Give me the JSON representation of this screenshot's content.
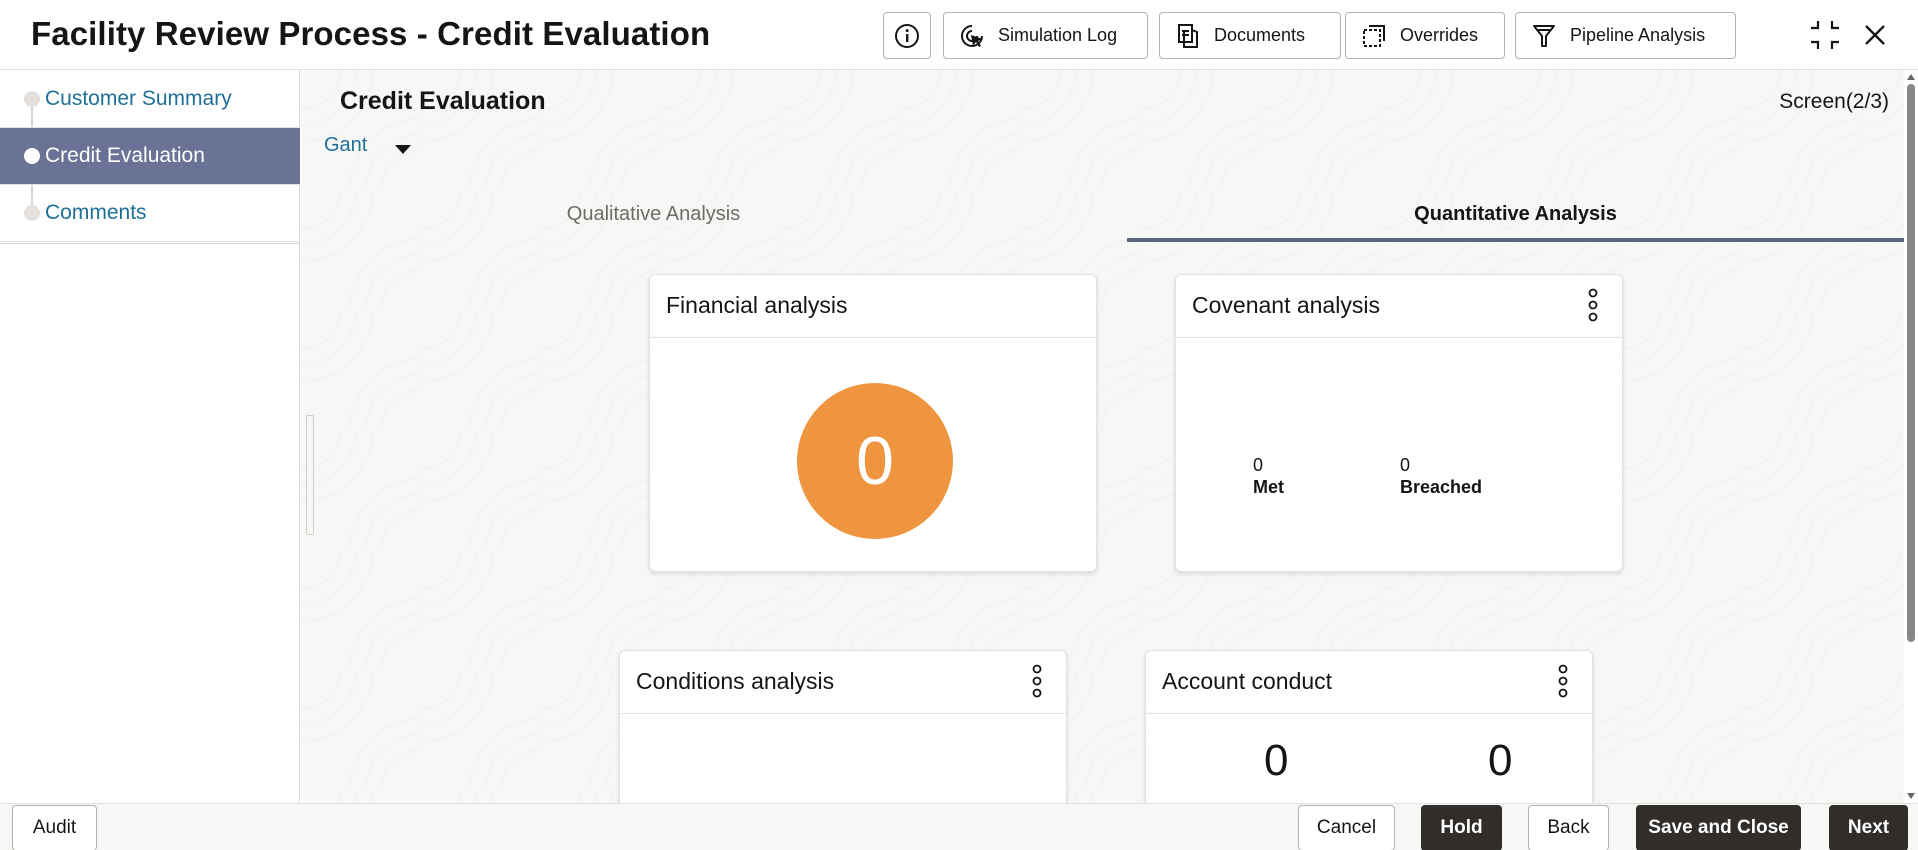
{
  "header": {
    "title": "Facility Review Process - Credit Evaluation",
    "buttons": {
      "simulation_log": "Simulation Log",
      "documents": "Documents",
      "overrides": "Overrides",
      "pipeline_analysis": "Pipeline Analysis"
    }
  },
  "nav": {
    "items": [
      {
        "label": "Customer Summary"
      },
      {
        "label": "Credit Evaluation"
      },
      {
        "label": "Comments"
      }
    ]
  },
  "main": {
    "section_title": "Credit Evaluation",
    "screen_indicator": "Screen(2/3)",
    "gant_value": "Gant",
    "tabs": [
      {
        "label": "Qualitative Analysis"
      },
      {
        "label": "Quantitative Analysis"
      }
    ]
  },
  "cards": {
    "financial": {
      "title": "Financial analysis",
      "value": "0",
      "color": "#f0953f"
    },
    "covenant": {
      "title": "Covenant analysis",
      "met_value": "0",
      "met_label": "Met",
      "breached_value": "0",
      "breached_label": "Breached"
    },
    "conditions": {
      "title": "Conditions analysis"
    },
    "account": {
      "title": "Account conduct",
      "value_a": "0",
      "value_b": "0"
    }
  },
  "footer": {
    "audit": "Audit",
    "cancel": "Cancel",
    "hold": "Hold",
    "back": "Back",
    "save_close": "Save and Close",
    "next": "Next"
  },
  "colors": {
    "active_nav": "#6a7396",
    "link": "#1f6f98",
    "tab_underline": "#5a6585",
    "dark_button": "#312d2a"
  }
}
